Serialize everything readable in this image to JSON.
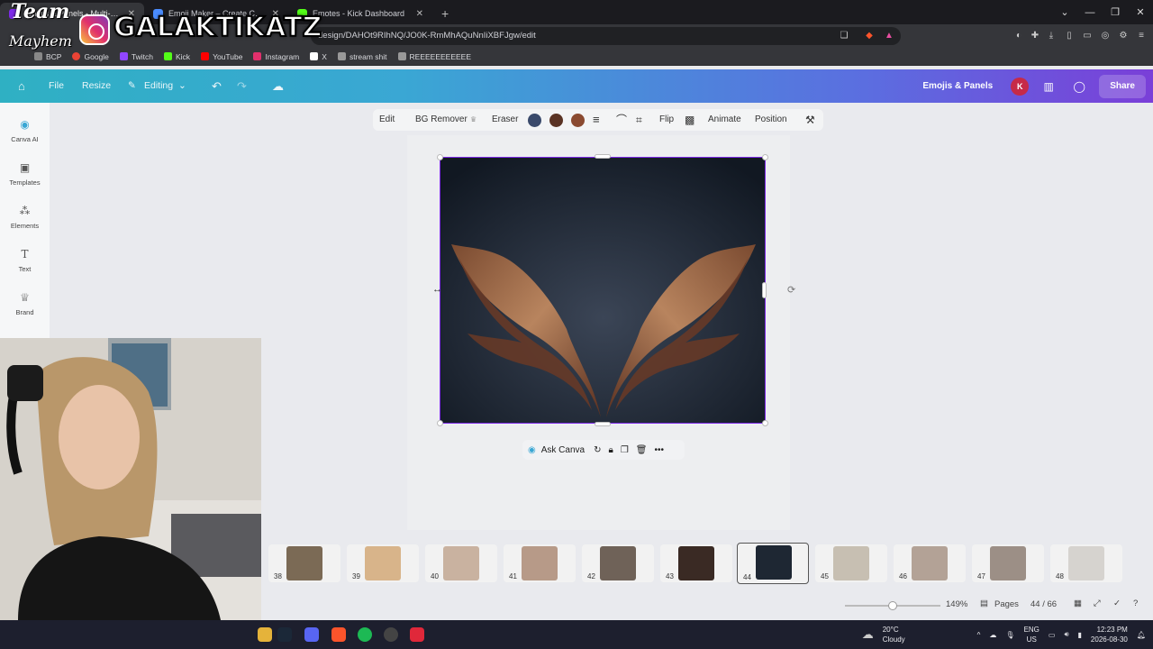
{
  "browser": {
    "tabs": [
      {
        "title": "Emojis & Panels - Multi-design",
        "active": true,
        "favicon_color": "#7d2ae8"
      },
      {
        "title": "Emoji Maker – Create Custom Emojis",
        "active": false,
        "favicon_color": "#4a8cff"
      },
      {
        "title": "Emotes - Kick Dashboard",
        "active": false,
        "favicon_color": "#53fc18"
      }
    ],
    "new_tab_icon": "plus-icon",
    "url": "design/DAHOt9RIhNQ/JO0K-RmMhAQuNnIiXBFJgw/edit",
    "bookmarks": [
      {
        "label": "BCP",
        "color": "#888888"
      },
      {
        "label": "Google",
        "color": "#ea4335"
      },
      {
        "label": "Twitch",
        "color": "#9146ff"
      },
      {
        "label": "Kick",
        "color": "#53fc18"
      },
      {
        "label": "YouTube",
        "color": "#ff0000"
      },
      {
        "label": "Instagram",
        "color": "#e1306c"
      },
      {
        "label": "X",
        "color": "#ffffff"
      },
      {
        "label": "stream shit",
        "color": "#999999"
      },
      {
        "label": "REEEEEEEEEEE",
        "color": "#999999"
      }
    ]
  },
  "overlay": {
    "team_text": "Team",
    "mayhem_text": "Mayhem",
    "handle": "GALAKTIKATZ"
  },
  "canva": {
    "menu": {
      "file": "File",
      "resize": "Resize",
      "editing": "Editing"
    },
    "project_name": "Emojis & Panels",
    "avatar_initial": "K",
    "share": "Share",
    "rail": [
      {
        "label": "Canva AI",
        "icon": "canva-ai-icon"
      },
      {
        "label": "Templates",
        "icon": "templates-icon"
      },
      {
        "label": "Elements",
        "icon": "elements-icon"
      },
      {
        "label": "Text",
        "icon": "text-icon"
      },
      {
        "label": "Brand",
        "icon": "brand-icon"
      }
    ],
    "toolbar": {
      "edit": "Edit",
      "bg_remover": "BG Remover",
      "eraser": "Eraser",
      "flip": "Flip",
      "animate": "Animate",
      "position": "Position",
      "swatches": [
        "#3a4a6b",
        "#5a3324",
        "#8a4a30"
      ]
    },
    "ask_canva": "Ask Canva",
    "pages": [
      {
        "num": "38",
        "color": "#7b6a55"
      },
      {
        "num": "39",
        "color": "#d8b48a"
      },
      {
        "num": "40",
        "color": "#c9b2a0"
      },
      {
        "num": "41",
        "color": "#b79a88"
      },
      {
        "num": "42",
        "color": "#6f6258"
      },
      {
        "num": "43",
        "color": "#3a2a24"
      },
      {
        "num": "44",
        "color": "#1e2733",
        "selected": true
      },
      {
        "num": "45",
        "color": "#c7bfb2"
      },
      {
        "num": "46",
        "color": "#b3a296"
      },
      {
        "num": "47",
        "color": "#9c8f86"
      },
      {
        "num": "48",
        "color": "#d6d3cf"
      }
    ],
    "status": {
      "zoom": "149%",
      "zoom_level": 0.5,
      "pages_label": "Pages",
      "page_counter": "44 / 66"
    }
  },
  "taskbar": {
    "weather_temp": "20°C",
    "weather_desc": "Cloudy",
    "lang_top": "ENG",
    "lang_bottom": "US",
    "time": "12:23 PM",
    "date": "2026-08-30"
  }
}
